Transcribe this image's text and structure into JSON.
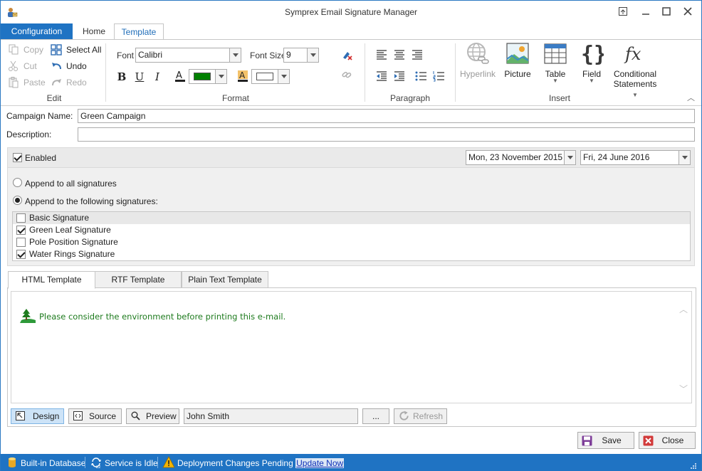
{
  "window": {
    "title": "Symprex Email Signature Manager",
    "buttons": [
      "restore-down",
      "minimize",
      "maximize",
      "close"
    ]
  },
  "ribbon_tabs": {
    "file": "Configuration",
    "home": "Home",
    "template": "Template",
    "active": "Template"
  },
  "ribbon": {
    "edit": {
      "copy": "Copy",
      "cut": "Cut",
      "paste": "Paste",
      "select_all": "Select All",
      "undo": "Undo",
      "redo": "Redo",
      "label": "Edit"
    },
    "format": {
      "font_label": "Font",
      "font_value": "Calibri",
      "font_size_label": "Font Size",
      "font_size_value": "9",
      "bold": "B",
      "underline": "U",
      "italic": "I",
      "font_color": "#008000",
      "highlight_color": "#ffffff",
      "label": "Format"
    },
    "paragraph": {
      "label": "Paragraph"
    },
    "insert": {
      "hyperlink": "Hyperlink",
      "picture": "Picture",
      "table": "Table",
      "field": "Field",
      "conditional_line1": "Conditional",
      "conditional_line2": "Statements",
      "label": "Insert"
    }
  },
  "form": {
    "campaign_name_label": "Campaign Name:",
    "campaign_name_value": "Green Campaign",
    "description_label": "Description:",
    "description_value": ""
  },
  "options": {
    "enabled_label": "Enabled",
    "enabled": true,
    "start_date": "Mon, 23 November 2015",
    "end_date": "Fri, 24 June 2016",
    "append_all_label": "Append to all signatures",
    "append_following_label": "Append to the following signatures:",
    "append_mode": "following",
    "signatures": [
      {
        "name": "Basic Signature",
        "checked": false
      },
      {
        "name": "Green Leaf Signature",
        "checked": true
      },
      {
        "name": "Pole Position Signature",
        "checked": false
      },
      {
        "name": "Water Rings Signature",
        "checked": true
      }
    ]
  },
  "template_tabs": {
    "html": "HTML Template",
    "rtf": "RTF Template",
    "plain": "Plain Text Template",
    "active": "HTML Template"
  },
  "editor": {
    "content": "Please consider the environment before printing this e-mail.",
    "content_color": "#1e7b1e"
  },
  "editor_toolbar": {
    "design": "Design",
    "source": "Source",
    "preview": "Preview",
    "preview_user": "John Smith",
    "browse": "...",
    "refresh": "Refresh"
  },
  "actions": {
    "save": "Save",
    "close": "Close"
  },
  "status": {
    "database": "Built-in Database",
    "service": "Service is Idle",
    "deployment": "Deployment Changes Pending",
    "update_link": "Update Now",
    "accent": "#1f73c3"
  }
}
